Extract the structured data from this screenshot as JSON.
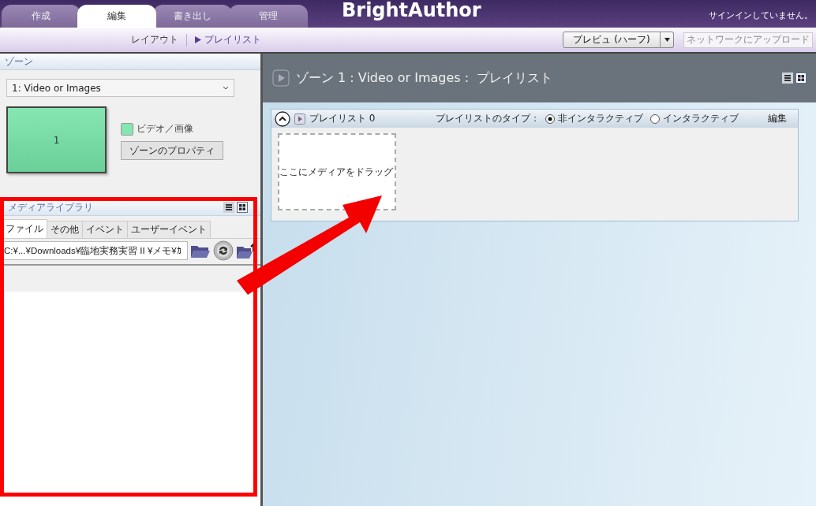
{
  "top_bar": {
    "tabs": [
      {
        "label": "作成",
        "selected": false
      },
      {
        "label": "編集",
        "selected": true
      },
      {
        "label": "書き出し",
        "selected": false
      },
      {
        "label": "管理",
        "selected": false
      }
    ],
    "logo": "BrightAuthor",
    "signin_status": "サインインしていません。"
  },
  "sub_bar": {
    "items": [
      {
        "label": "レイアウト",
        "selected": false
      },
      {
        "label": "プレイリスト",
        "selected": true
      }
    ],
    "preview_button": "プレビュ (ハーフ)",
    "upload_button": {
      "label": "ネットワークにアップロード",
      "disabled": true
    }
  },
  "zone_panel": {
    "title": "ゾーン",
    "zone_select": "1: Video or Images",
    "zone_number": "1",
    "legend": "ビデオ／画像",
    "properties_button": "ゾーンのプロパティ"
  },
  "media_library": {
    "title": "メディアライブラリ",
    "views": [
      {
        "kind": "list",
        "selected": false
      },
      {
        "kind": "grid",
        "selected": true
      }
    ],
    "tabs": [
      {
        "label": "ファイル",
        "selected": true
      },
      {
        "label": "その他",
        "selected": false
      },
      {
        "label": "イベント",
        "selected": false
      },
      {
        "label": "ユーザーイベント",
        "selected": false
      }
    ],
    "path": "C:¥...¥Downloads¥臨地実務実習 II ¥メモ¥ｶ"
  },
  "playlist_view": {
    "title": "ゾーン 1 : Video or Images :  プレイリスト",
    "views": [
      {
        "kind": "list",
        "selected": false
      },
      {
        "kind": "grid",
        "selected": true
      }
    ],
    "playlist": {
      "name": "プレイリスト 0",
      "expanded": true,
      "type_label": "プレイリストのタイプ：",
      "types": [
        {
          "label": "非インタラクティブ",
          "selected": true
        },
        {
          "label": "インタラクティブ",
          "selected": false
        }
      ],
      "edit": "編集",
      "drop_hint": "ここにメディアをドラッグ"
    }
  }
}
